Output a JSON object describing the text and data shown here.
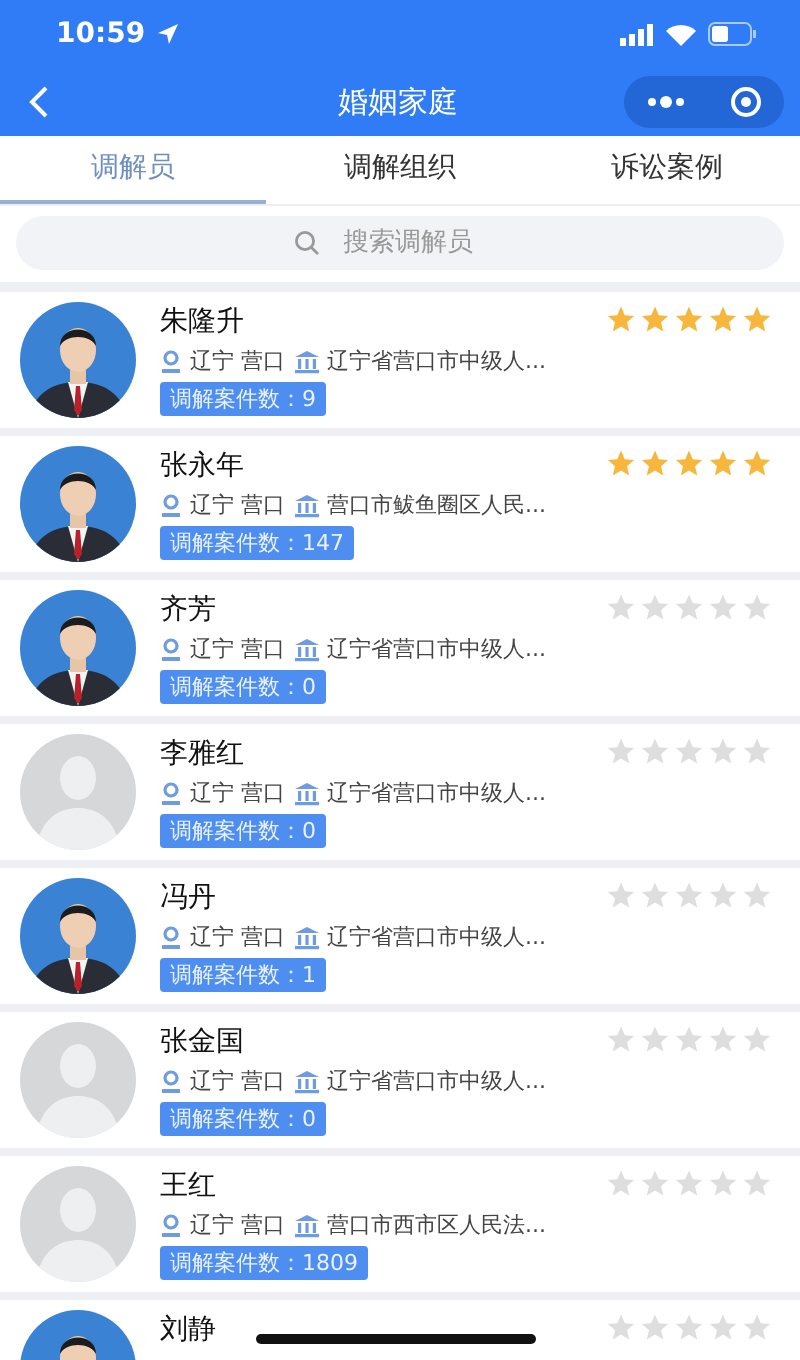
{
  "status_bar": {
    "time": "10:59"
  },
  "nav": {
    "title": "婚姻家庭"
  },
  "tabs": [
    {
      "label": "调解员",
      "selected": true
    },
    {
      "label": "调解组织",
      "selected": false
    },
    {
      "label": "诉讼案例",
      "selected": false
    }
  ],
  "search": {
    "placeholder": "搜索调解员"
  },
  "mediators": [
    {
      "name": "朱隆升",
      "kind": "picture",
      "location": "辽宁 营口",
      "org": "辽宁省营口市中级人...",
      "cases": "调解案件数：9",
      "stars": 5
    },
    {
      "name": "张永年",
      "kind": "picture",
      "location": "辽宁 营口",
      "org": "营口市鲅鱼圈区人民...",
      "cases": "调解案件数：147",
      "stars": 5
    },
    {
      "name": "齐芳",
      "kind": "picture",
      "location": "辽宁 营口",
      "org": "辽宁省营口市中级人...",
      "cases": "调解案件数：0",
      "stars": 0
    },
    {
      "name": "李雅红",
      "kind": "placeholder",
      "location": "辽宁 营口",
      "org": "辽宁省营口市中级人...",
      "cases": "调解案件数：0",
      "stars": 0
    },
    {
      "name": "冯丹",
      "kind": "picture",
      "location": "辽宁 营口",
      "org": "辽宁省营口市中级人...",
      "cases": "调解案件数：1",
      "stars": 0
    },
    {
      "name": "张金国",
      "kind": "placeholder",
      "location": "辽宁 营口",
      "org": "辽宁省营口市中级人...",
      "cases": "调解案件数：0",
      "stars": 0
    },
    {
      "name": "王红",
      "kind": "placeholder",
      "location": "辽宁 营口",
      "org": "营口市西市区人民法...",
      "cases": "调解案件数：1809",
      "stars": 0
    },
    {
      "name": "刘静",
      "kind": "picture",
      "stars": 0
    }
  ]
}
